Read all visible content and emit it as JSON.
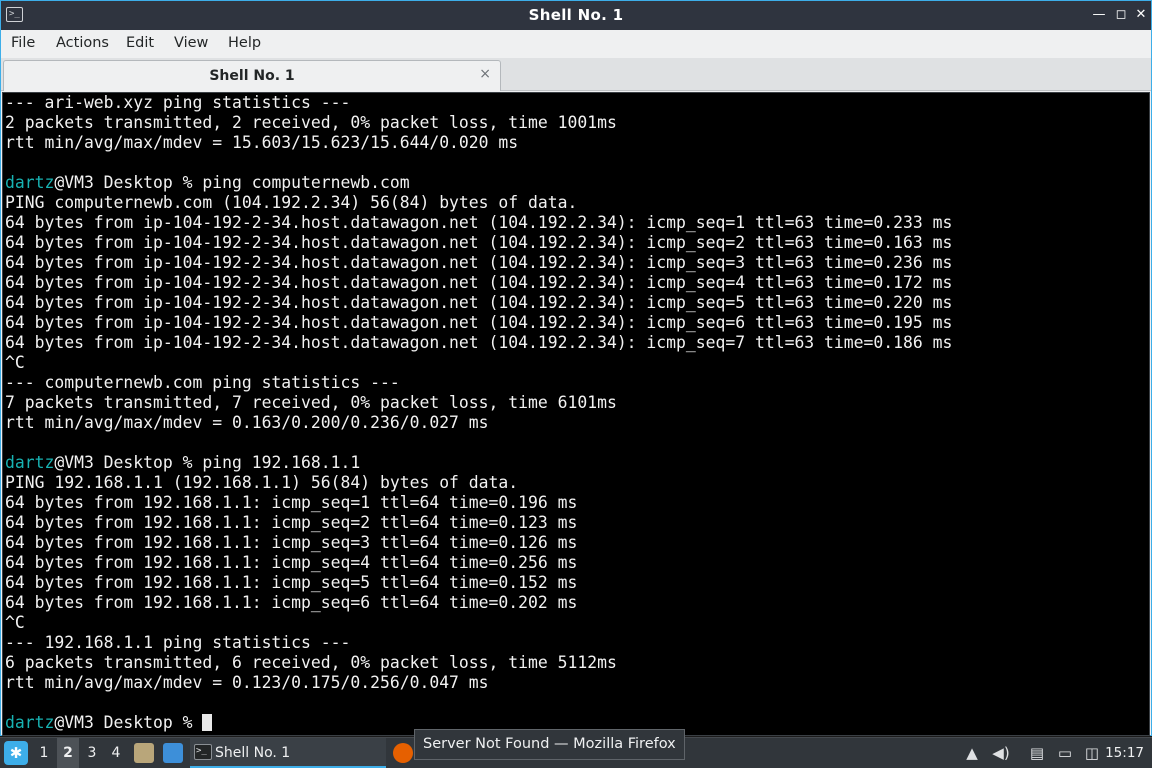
{
  "window": {
    "title": "Shell No. 1",
    "controls": {
      "minimize": "—",
      "maximize": "◻",
      "close": "✕"
    }
  },
  "menu": [
    "File",
    "Actions",
    "Edit",
    "View",
    "Help"
  ],
  "tabs": [
    {
      "label": "Shell No. 1",
      "close": "×"
    }
  ],
  "terminal": {
    "lines": [
      {
        "text": "--- ari-web.xyz ping statistics ---"
      },
      {
        "text": "2 packets transmitted, 2 received, 0% packet loss, time 1001ms"
      },
      {
        "text": "rtt min/avg/max/mdev = 15.603/15.623/15.644/0.020 ms"
      },
      {
        "text": ""
      },
      {
        "user": "dartz",
        "rest": "@VM3 Desktop % ping computernewb.com"
      },
      {
        "text": "PING computernewb.com (104.192.2.34) 56(84) bytes of data."
      },
      {
        "text": "64 bytes from ip-104-192-2-34.host.datawagon.net (104.192.2.34): icmp_seq=1 ttl=63 time=0.233 ms"
      },
      {
        "text": "64 bytes from ip-104-192-2-34.host.datawagon.net (104.192.2.34): icmp_seq=2 ttl=63 time=0.163 ms"
      },
      {
        "text": "64 bytes from ip-104-192-2-34.host.datawagon.net (104.192.2.34): icmp_seq=3 ttl=63 time=0.236 ms"
      },
      {
        "text": "64 bytes from ip-104-192-2-34.host.datawagon.net (104.192.2.34): icmp_seq=4 ttl=63 time=0.172 ms"
      },
      {
        "text": "64 bytes from ip-104-192-2-34.host.datawagon.net (104.192.2.34): icmp_seq=5 ttl=63 time=0.220 ms"
      },
      {
        "text": "64 bytes from ip-104-192-2-34.host.datawagon.net (104.192.2.34): icmp_seq=6 ttl=63 time=0.195 ms"
      },
      {
        "text": "64 bytes from ip-104-192-2-34.host.datawagon.net (104.192.2.34): icmp_seq=7 ttl=63 time=0.186 ms"
      },
      {
        "text": "^C"
      },
      {
        "text": "--- computernewb.com ping statistics ---"
      },
      {
        "text": "7 packets transmitted, 7 received, 0% packet loss, time 6101ms"
      },
      {
        "text": "rtt min/avg/max/mdev = 0.163/0.200/0.236/0.027 ms"
      },
      {
        "text": ""
      },
      {
        "user": "dartz",
        "rest": "@VM3 Desktop % ping 192.168.1.1"
      },
      {
        "text": "PING 192.168.1.1 (192.168.1.1) 56(84) bytes of data."
      },
      {
        "text": "64 bytes from 192.168.1.1: icmp_seq=1 ttl=64 time=0.196 ms"
      },
      {
        "text": "64 bytes from 192.168.1.1: icmp_seq=2 ttl=64 time=0.123 ms"
      },
      {
        "text": "64 bytes from 192.168.1.1: icmp_seq=3 ttl=64 time=0.126 ms"
      },
      {
        "text": "64 bytes from 192.168.1.1: icmp_seq=4 ttl=64 time=0.256 ms"
      },
      {
        "text": "64 bytes from 192.168.1.1: icmp_seq=5 ttl=64 time=0.152 ms"
      },
      {
        "text": "64 bytes from 192.168.1.1: icmp_seq=6 ttl=64 time=0.202 ms"
      },
      {
        "text": "^C"
      },
      {
        "text": "--- 192.168.1.1 ping statistics ---"
      },
      {
        "text": "6 packets transmitted, 6 received, 0% packet loss, time 5112ms"
      },
      {
        "text": "rtt min/avg/max/mdev = 0.123/0.175/0.256/0.047 ms"
      },
      {
        "text": ""
      },
      {
        "user": "dartz",
        "rest": "@VM3 Desktop % ",
        "cursor": true
      }
    ]
  },
  "taskbar": {
    "workspaces": [
      "1",
      "2",
      "3",
      "4"
    ],
    "active_workspace": "2",
    "tasks": [
      {
        "label": "Shell No. 1",
        "icon": "terminal-icon"
      }
    ],
    "firefox_icon": "firefox-icon",
    "tooltip": "Server Not Found — Mozilla Firefox",
    "clock": "15:17"
  },
  "colors": {
    "terminal_bg": "#000000",
    "terminal_fg": "#f2f2f2",
    "prompt_user": "#18b2b2",
    "titlebar": "#2f343f",
    "accent": "#3daee9",
    "taskbar": "#31363b"
  }
}
